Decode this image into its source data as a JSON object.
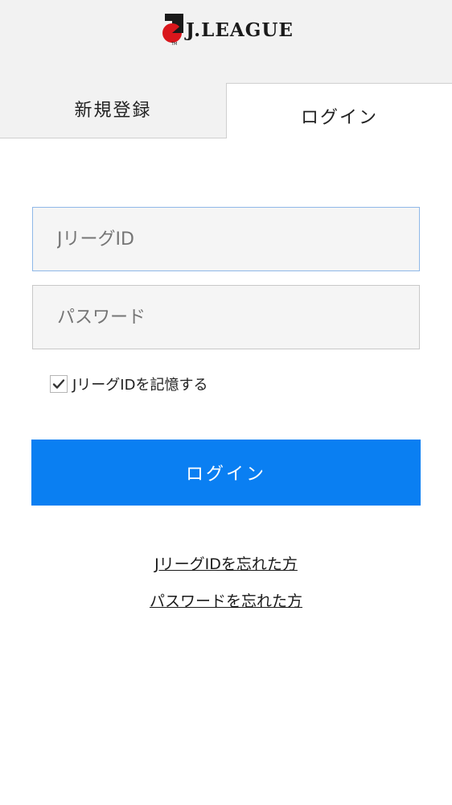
{
  "header": {
    "logo_text": "J.LEAGUE",
    "logo_icon": "jleague-logo-icon"
  },
  "tabs": [
    {
      "label": "新規登録",
      "active": false
    },
    {
      "label": "ログイン",
      "active": true
    }
  ],
  "form": {
    "id_placeholder": "JリーグID",
    "id_value": "",
    "password_placeholder": "パスワード",
    "password_value": "",
    "remember_label": "JリーグIDを記憶する",
    "remember_checked": true,
    "login_button": "ログイン"
  },
  "links": {
    "forgot_id": "JリーグIDを忘れた方",
    "forgot_password": "パスワードを忘れた方"
  },
  "colors": {
    "accent": "#0a7ff2",
    "header_bg": "#f2f2f2",
    "logo_red": "#d9161c",
    "logo_black": "#1a1a1a"
  }
}
